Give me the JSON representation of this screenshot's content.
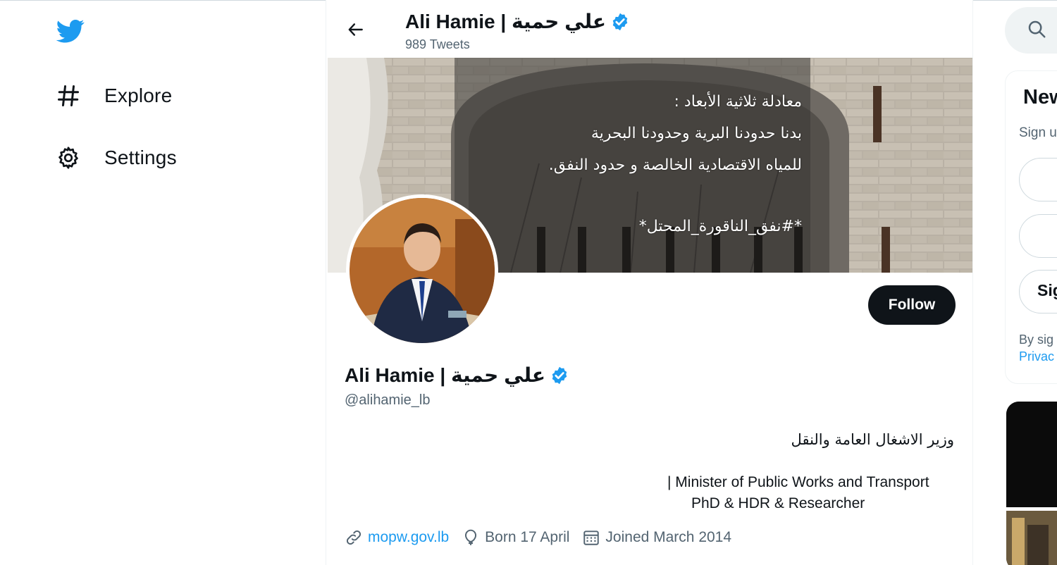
{
  "left_nav": {
    "logo_icon": "twitter-bird-icon",
    "items": [
      {
        "label": "Explore",
        "icon": "hashtag-icon"
      },
      {
        "label": "Settings",
        "icon": "gear-icon"
      }
    ]
  },
  "header": {
    "name": "Ali Hamie | علي حمية",
    "tweet_count": "989 Tweets"
  },
  "banner": {
    "line1": "معادلة ثلاثية الأبعاد :",
    "line2": "بدنا حدودنا البرية وحدودنا البحرية",
    "line3": "للمياه الاقتصادية الخالصة و حدود النفق.",
    "hashtag": "*#نفق_الناقورة_المحتل*"
  },
  "profile": {
    "name": "Ali Hamie | علي حمية",
    "handle": "@alihamie_lb",
    "follow_label": "Follow",
    "bio_arabic": "وزير الاشغال العامة والنقل",
    "bio_line1": "| Minister of Public Works and Transport",
    "bio_line2": "PhD & HDR & Researcher",
    "website": "mopw.gov.lb",
    "birthday": "Born 17 April",
    "joined": "Joined March 2014"
  },
  "right_sidebar": {
    "card_title": "New",
    "card_sub": "Sign u",
    "button3_label": "Sig",
    "terms_line1": "By sig",
    "terms_line2": "Privac"
  },
  "colors": {
    "accent": "#1d9bf0",
    "text_primary": "#0f1419",
    "text_secondary": "#536471",
    "follow_bg": "#0f1419"
  }
}
